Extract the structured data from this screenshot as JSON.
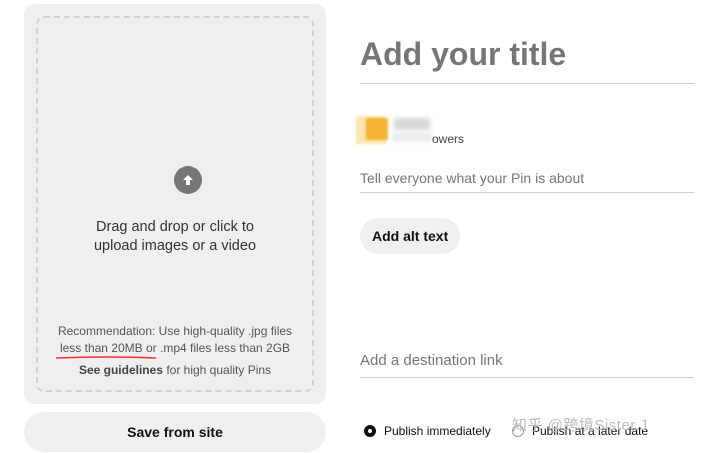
{
  "upload": {
    "drop_line1": "Drag and drop or click to",
    "drop_line2": "upload images or a video",
    "rec_line1": "Recommendation: Use high-quality .jpg files",
    "rec_line2": "less than 20MB or .mp4 files less than 2GB",
    "guidelines_link": "See guidelines",
    "guidelines_rest": " for high quality Pins"
  },
  "save_from_site": "Save from site",
  "form": {
    "title_placeholder": "Add your title",
    "followers_text": "owers",
    "about_placeholder": "Tell everyone what your Pin is about",
    "alt_text_button": "Add alt text",
    "destination_placeholder": "Add a destination link",
    "publish_immediately": "Publish immediately",
    "publish_later": "Publish at a later date"
  },
  "watermark": "知乎 @跨境Sister.J",
  "colors": {
    "annotation_red": "#e53935"
  }
}
